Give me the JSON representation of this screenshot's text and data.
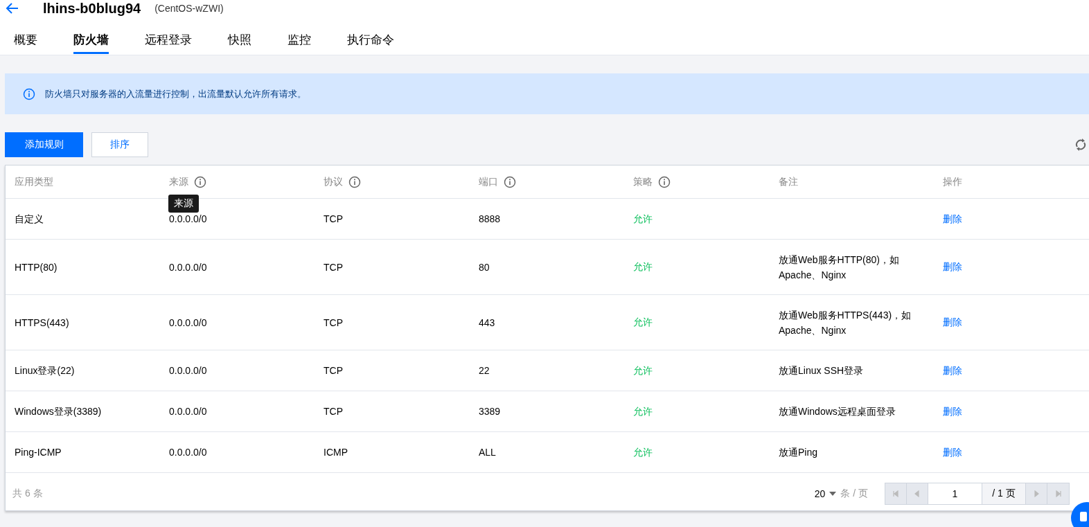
{
  "header": {
    "title": "lhins-b0blug94",
    "subtitle": "(CentOS-wZWI)"
  },
  "tabs": [
    {
      "label": "概要",
      "selected": false
    },
    {
      "label": "防火墙",
      "selected": true
    },
    {
      "label": "远程登录",
      "selected": false
    },
    {
      "label": "快照",
      "selected": false
    },
    {
      "label": "监控",
      "selected": false
    },
    {
      "label": "执行命令",
      "selected": false
    }
  ],
  "notice": "防火墙只对服务器的入流量进行控制，出流量默认允许所有请求。",
  "buttons": {
    "add": "添加规则",
    "sort": "排序"
  },
  "table": {
    "columns": [
      {
        "label": "应用类型",
        "info": false
      },
      {
        "label": "来源",
        "info": true
      },
      {
        "label": "协议",
        "info": true
      },
      {
        "label": "端口",
        "info": true
      },
      {
        "label": "策略",
        "info": true
      },
      {
        "label": "备注",
        "info": false
      },
      {
        "label": "操作",
        "info": false
      }
    ],
    "tooltip": "来源",
    "rows": [
      {
        "type": "自定义",
        "source": "0.0.0.0/0",
        "protocol": "TCP",
        "port": "8888",
        "policy": "允许",
        "note": "",
        "action": "删除"
      },
      {
        "type": "HTTP(80)",
        "source": "0.0.0.0/0",
        "protocol": "TCP",
        "port": "80",
        "policy": "允许",
        "note": "放通Web服务HTTP(80)，如 Apache、Nginx",
        "action": "删除"
      },
      {
        "type": "HTTPS(443)",
        "source": "0.0.0.0/0",
        "protocol": "TCP",
        "port": "443",
        "policy": "允许",
        "note": "放通Web服务HTTPS(443)，如 Apache、Nginx",
        "action": "删除"
      },
      {
        "type": "Linux登录(22)",
        "source": "0.0.0.0/0",
        "protocol": "TCP",
        "port": "22",
        "policy": "允许",
        "note": "放通Linux SSH登录",
        "action": "删除"
      },
      {
        "type": "Windows登录(3389)",
        "source": "0.0.0.0/0",
        "protocol": "TCP",
        "port": "3389",
        "policy": "允许",
        "note": "放通Windows远程桌面登录",
        "action": "删除"
      },
      {
        "type": "Ping-ICMP",
        "source": "0.0.0.0/0",
        "protocol": "ICMP",
        "port": "ALL",
        "policy": "允许",
        "note": "放通Ping",
        "action": "删除"
      }
    ]
  },
  "footer": {
    "total": "共 6 条",
    "page_size": "20",
    "per_page": "条 / 页",
    "page": "1",
    "page_total": "/ 1 页"
  }
}
